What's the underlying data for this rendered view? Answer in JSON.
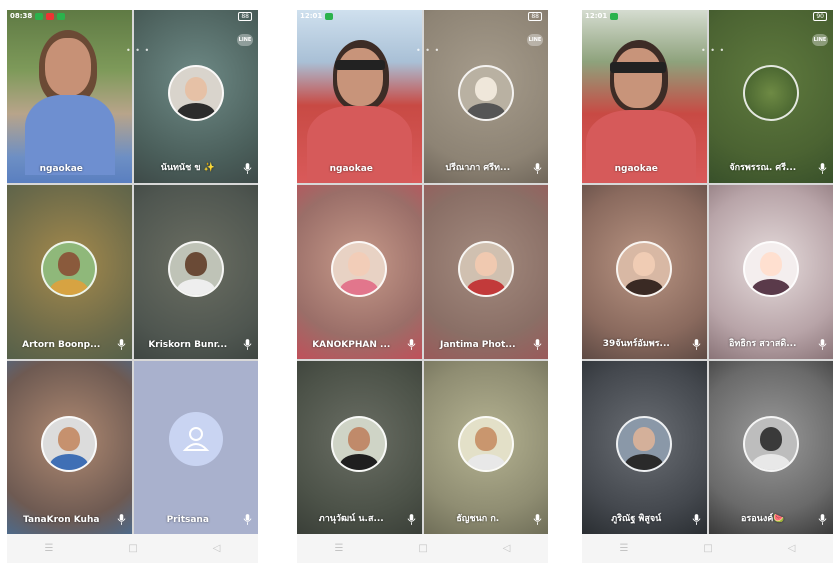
{
  "phone1": {
    "status_time": "08:38",
    "battery": "88",
    "line_badge": "LINE",
    "tiles": [
      {
        "name": "ngaokae"
      },
      {
        "name": "นันทนัช ข ✨"
      },
      {
        "name": "Artorn Boonp..."
      },
      {
        "name": "Kriskorn Bunr..."
      },
      {
        "name": "TanaKron Kuha"
      },
      {
        "name": "Pritsana"
      }
    ]
  },
  "phone2": {
    "status_time": "12:01",
    "battery": "88",
    "line_badge": "LINE",
    "tiles": [
      {
        "name": "ngaokae"
      },
      {
        "name": "ปรีณาภา ศรีท..."
      },
      {
        "name": "KANOKPHAN ..."
      },
      {
        "name": "Jantima Phot..."
      },
      {
        "name": "ภานุวัฒน์ น.ส..."
      },
      {
        "name": "ธัญชนก ก."
      }
    ]
  },
  "phone3": {
    "status_time": "12:01",
    "battery": "90",
    "line_badge": "LINE",
    "tiles": [
      {
        "name": "ngaokae"
      },
      {
        "name": "จักรพรรณ. ศรี..."
      },
      {
        "name": "39จันทร์อัมพร..."
      },
      {
        "name": "อิทธิกร สวาสดิ..."
      },
      {
        "name": "ภูริณัฐ พิสูจน์"
      },
      {
        "name": "อรอนงค์🍉"
      }
    ]
  },
  "navbar": {
    "menu_icon": "☰",
    "home_icon": "□",
    "back_icon": "◁"
  },
  "icons": [
    "microphone-icon",
    "person-icon",
    "line-app-icon"
  ]
}
